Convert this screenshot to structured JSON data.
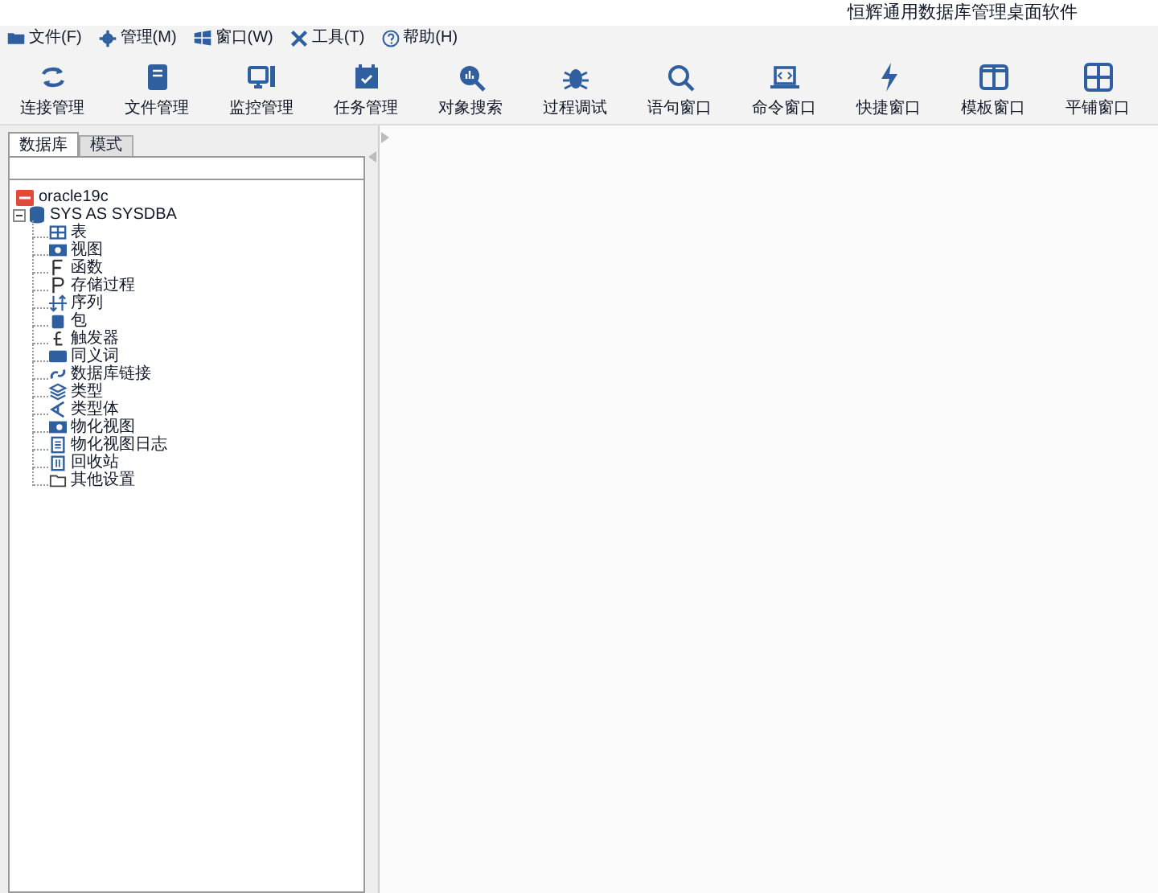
{
  "window": {
    "title": "恒辉通用数据库管理桌面软件"
  },
  "menu": [
    "文件(F)",
    "管理(M)",
    "窗口(W)",
    "工具(T)",
    "帮助(H)"
  ],
  "toolbar": [
    "连接管理",
    "文件管理",
    "监控管理",
    "任务管理",
    "对象搜索",
    "过程调试",
    "语句窗口",
    "命令窗口",
    "快捷窗口",
    "模板窗口",
    "平铺窗口"
  ],
  "tabs": [
    {
      "label": "数据库",
      "selected": true
    },
    {
      "label": "模式",
      "selected": false
    }
  ],
  "tree": [
    {
      "label": "oracle19c"
    },
    {
      "label": "SYS AS SYSDBA",
      "expanded": true,
      "children": [
        {
          "label": "表"
        },
        {
          "label": "视图"
        },
        {
          "label": "函数"
        },
        {
          "label": "存储过程"
        },
        {
          "label": "序列"
        },
        {
          "label": "包"
        },
        {
          "label": "触发器"
        },
        {
          "label": "同义词"
        },
        {
          "label": "数据库链接"
        },
        {
          "label": "类型"
        },
        {
          "label": "类型体"
        },
        {
          "label": "物化视图"
        },
        {
          "label": "物化视图日志"
        },
        {
          "label": "回收站"
        },
        {
          "label": "其他设置"
        }
      ]
    }
  ]
}
